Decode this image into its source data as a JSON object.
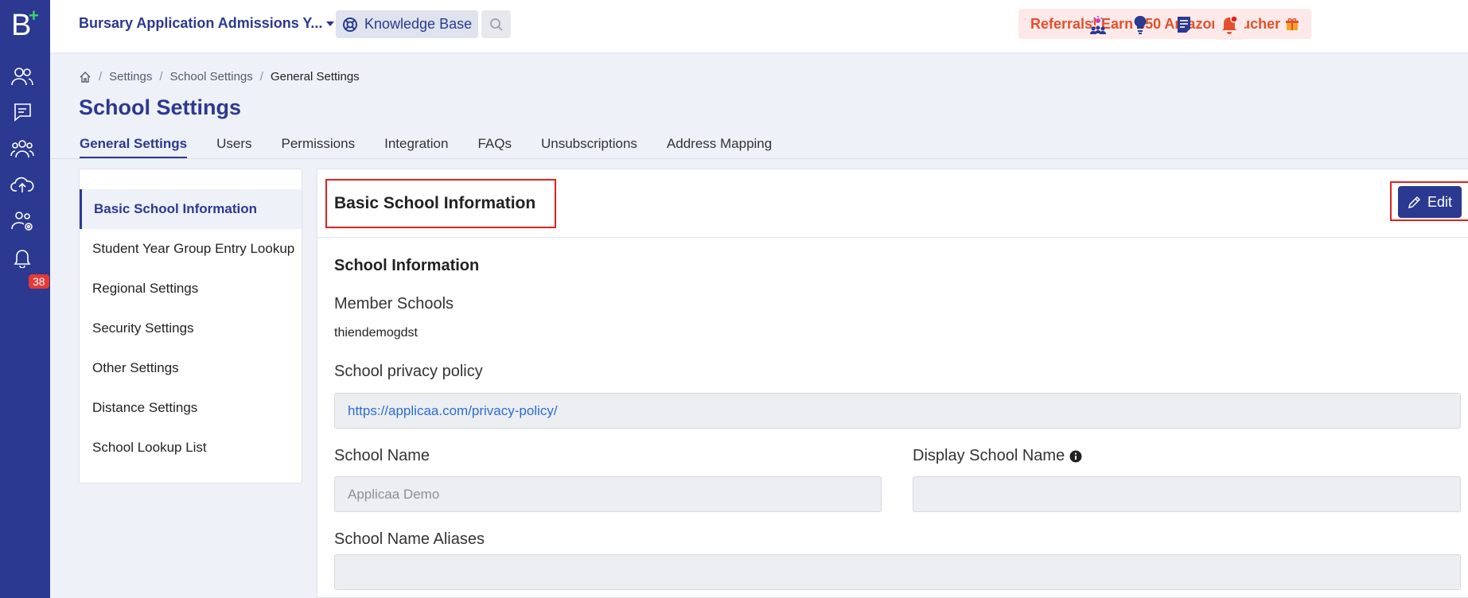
{
  "rail": {
    "logo": "B",
    "notification_count": "38"
  },
  "topbar": {
    "app_name": "Bursary Application Admissions Y...",
    "knowledge_base": "Knowledge Base",
    "referral": "Referrals! Earn £50 Amazon Voucher"
  },
  "breadcrumb": {
    "settings": "Settings",
    "school_settings": "School Settings",
    "current": "General Settings"
  },
  "page": {
    "title": "School Settings"
  },
  "tabs": [
    "General Settings",
    "Users",
    "Permissions",
    "Integration",
    "FAQs",
    "Unsubscriptions",
    "Address Mapping"
  ],
  "side_menu": [
    "Basic School Information",
    "Student Year Group Entry Lookup",
    "Regional Settings",
    "Security Settings",
    "Other Settings",
    "Distance Settings",
    "School Lookup List"
  ],
  "panel": {
    "title": "Basic School Information",
    "edit_label": "Edit",
    "section_title": "School Information",
    "member_schools_label": "Member Schools",
    "member_schools_value": "thiendemogdst",
    "privacy_label": "School privacy policy",
    "privacy_value": "https://applicaa.com/privacy-policy/",
    "school_name_label": "School Name",
    "school_name_placeholder": "Applicaa Demo",
    "display_name_label": "Display School Name",
    "display_name_value": "",
    "aliases_label": "School Name Aliases",
    "aliases_value": ""
  },
  "colors": {
    "brand": "#2b3990",
    "referral_text": "#e4502b",
    "highlight_border": "#e02020"
  }
}
